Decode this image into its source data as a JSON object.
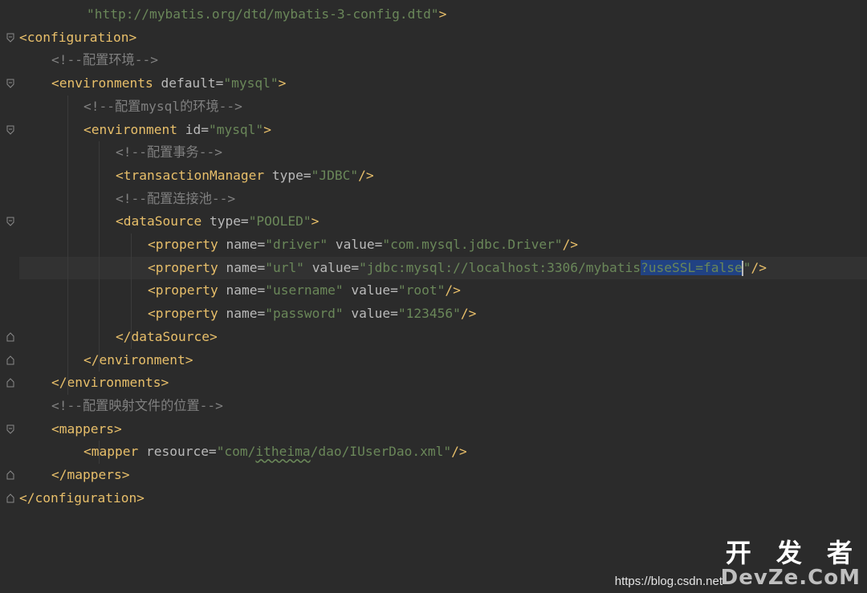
{
  "editor": {
    "lines": [
      {
        "segments": [
          {
            "cls": "val",
            "text": "\"http://mybatis.org/dtd/mybatis-3-config.dtd\""
          },
          {
            "cls": "punc",
            "text": ">"
          }
        ]
      },
      {
        "segments": [
          {
            "cls": "tag",
            "text": "<configuration>"
          }
        ]
      },
      {
        "segments": [
          {
            "cls": "cmt",
            "text": "<!--配置环境-->"
          }
        ]
      },
      {
        "segments": [
          {
            "cls": "tag",
            "text": "<environments "
          },
          {
            "cls": "attr",
            "text": "default="
          },
          {
            "cls": "val",
            "text": "\"mysql\""
          },
          {
            "cls": "tag",
            "text": ">"
          }
        ]
      },
      {
        "segments": [
          {
            "cls": "cmt",
            "text": "<!--配置mysql的环境-->"
          }
        ]
      },
      {
        "segments": [
          {
            "cls": "tag",
            "text": "<environment "
          },
          {
            "cls": "attr",
            "text": "id="
          },
          {
            "cls": "val",
            "text": "\"mysql\""
          },
          {
            "cls": "tag",
            "text": ">"
          }
        ]
      },
      {
        "segments": [
          {
            "cls": "cmt",
            "text": "<!--配置事务-->"
          }
        ]
      },
      {
        "segments": [
          {
            "cls": "tag",
            "text": "<transactionManager "
          },
          {
            "cls": "attr",
            "text": "type="
          },
          {
            "cls": "val",
            "text": "\"JDBC\""
          },
          {
            "cls": "tag",
            "text": "/>"
          }
        ]
      },
      {
        "segments": [
          {
            "cls": "cmt",
            "text": "<!--配置连接池-->"
          }
        ]
      },
      {
        "segments": [
          {
            "cls": "tag",
            "text": "<dataSource "
          },
          {
            "cls": "attr",
            "text": "type="
          },
          {
            "cls": "val",
            "text": "\"POOLED\""
          },
          {
            "cls": "tag",
            "text": ">"
          }
        ]
      },
      {
        "segments": [
          {
            "cls": "tag",
            "text": "<property "
          },
          {
            "cls": "attr",
            "text": "name="
          },
          {
            "cls": "val",
            "text": "\"driver\" "
          },
          {
            "cls": "attr",
            "text": "value="
          },
          {
            "cls": "val",
            "text": "\"com.mysql.jdbc.Driver\""
          },
          {
            "cls": "tag",
            "text": "/>"
          }
        ]
      },
      {
        "segments": [
          {
            "cls": "tag",
            "text": "<property "
          },
          {
            "cls": "attr",
            "text": "name="
          },
          {
            "cls": "val",
            "text": "\"url\" "
          },
          {
            "cls": "attr",
            "text": "value="
          },
          {
            "cls": "val",
            "text": "\"jdbc:mysql://localhost:3306/mybatis"
          },
          {
            "cls": "sel",
            "text": "?useSSL=false"
          },
          {
            "cls": "caret",
            "text": ""
          },
          {
            "cls": "val",
            "text": "\""
          },
          {
            "cls": "tag",
            "text": "/>"
          }
        ]
      },
      {
        "segments": [
          {
            "cls": "tag",
            "text": "<property "
          },
          {
            "cls": "attr",
            "text": "name="
          },
          {
            "cls": "val",
            "text": "\"username\" "
          },
          {
            "cls": "attr",
            "text": "value="
          },
          {
            "cls": "val",
            "text": "\"root\""
          },
          {
            "cls": "tag",
            "text": "/>"
          }
        ]
      },
      {
        "segments": [
          {
            "cls": "tag",
            "text": "<property "
          },
          {
            "cls": "attr",
            "text": "name="
          },
          {
            "cls": "val",
            "text": "\"password\" "
          },
          {
            "cls": "attr",
            "text": "value="
          },
          {
            "cls": "val",
            "text": "\"123456\""
          },
          {
            "cls": "tag",
            "text": "/>"
          }
        ]
      },
      {
        "segments": [
          {
            "cls": "tag",
            "text": "</dataSource>"
          }
        ]
      },
      {
        "segments": [
          {
            "cls": "tag",
            "text": "</environment>"
          }
        ]
      },
      {
        "segments": [
          {
            "cls": "tag",
            "text": "</environments>"
          }
        ]
      },
      {
        "segments": [
          {
            "cls": "cmt",
            "text": "<!--配置映射文件的位置-->"
          }
        ]
      },
      {
        "segments": [
          {
            "cls": "tag",
            "text": "<mappers>"
          }
        ]
      },
      {
        "segments": [
          {
            "cls": "tag",
            "text": "<mapper "
          },
          {
            "cls": "attr",
            "text": "resource="
          },
          {
            "cls": "val",
            "text": "\"com/"
          },
          {
            "cls": "val typo",
            "text": "itheima"
          },
          {
            "cls": "val",
            "text": "/dao/IUserDao.xml\""
          },
          {
            "cls": "tag",
            "text": "/>"
          }
        ]
      },
      {
        "segments": [
          {
            "cls": "tag",
            "text": "</mappers>"
          }
        ]
      },
      {
        "segments": [
          {
            "cls": "tag",
            "text": "</configuration>"
          }
        ]
      }
    ]
  },
  "watermark": {
    "url": "https://blog.csdn.net",
    "brand": "开 发 者",
    "site": "DevZe.CoM"
  },
  "colors": {
    "background": "#2b2b2b",
    "tag": "#e8bf6a",
    "attribute": "#bababa",
    "string": "#6a8759",
    "comment": "#808080",
    "selection": "#214283"
  }
}
